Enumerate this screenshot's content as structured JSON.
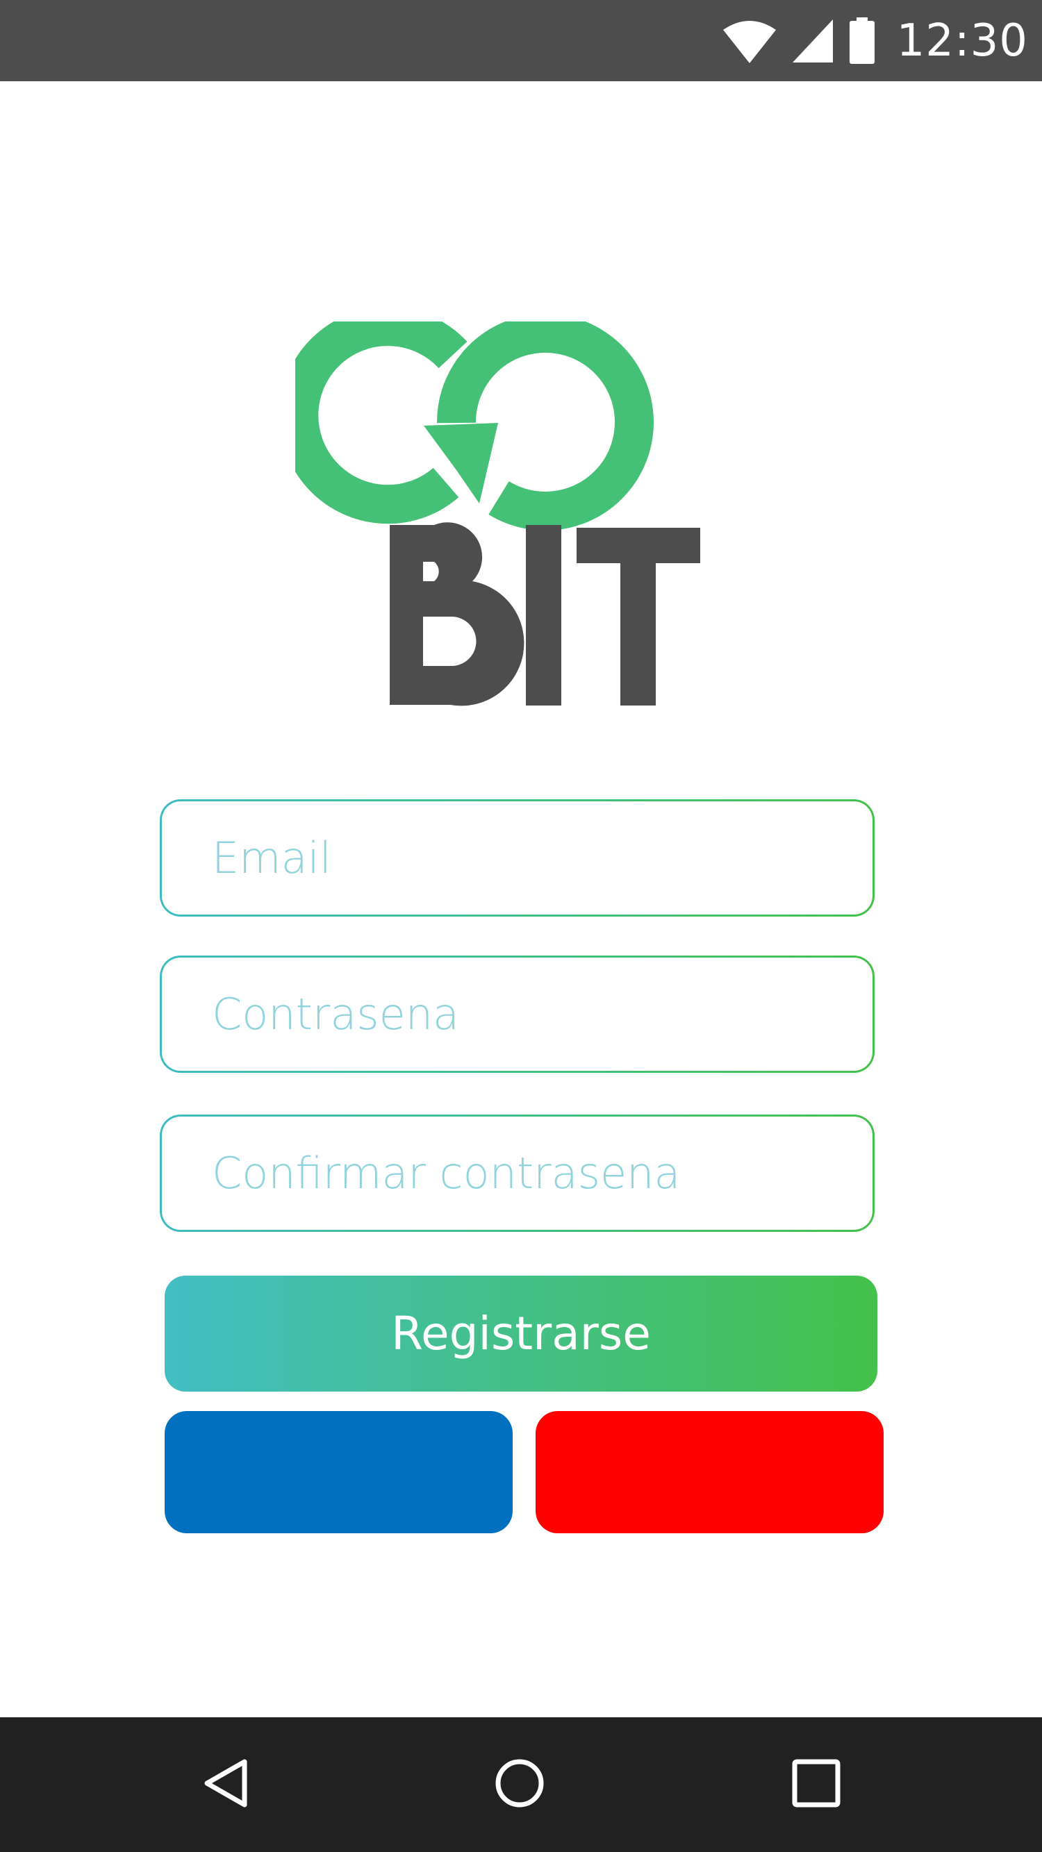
{
  "status_bar": {
    "time": "12:30",
    "icons": [
      "wifi-icon",
      "cell-signal-icon",
      "battery-icon"
    ],
    "background_color": "#4d4d4d"
  },
  "logo": {
    "text_top": "GO",
    "text_bottom": "BIT",
    "colors": {
      "go": "#44c176",
      "bit": "#4d4d4d"
    }
  },
  "form": {
    "email_placeholder": "Email",
    "password_placeholder": "Contrasena",
    "confirm_password_placeholder": "Confirmar contrasena"
  },
  "buttons": {
    "register_label": "Registrarse",
    "register_gradient": [
      "#43bec3",
      "#43c14a"
    ],
    "blue_button_color": "#0070bf",
    "red_button_color": "#ff0000"
  },
  "nav_bar": {
    "icons": [
      "back-icon",
      "home-icon",
      "recent-apps-icon"
    ],
    "background_color": "#212121"
  }
}
